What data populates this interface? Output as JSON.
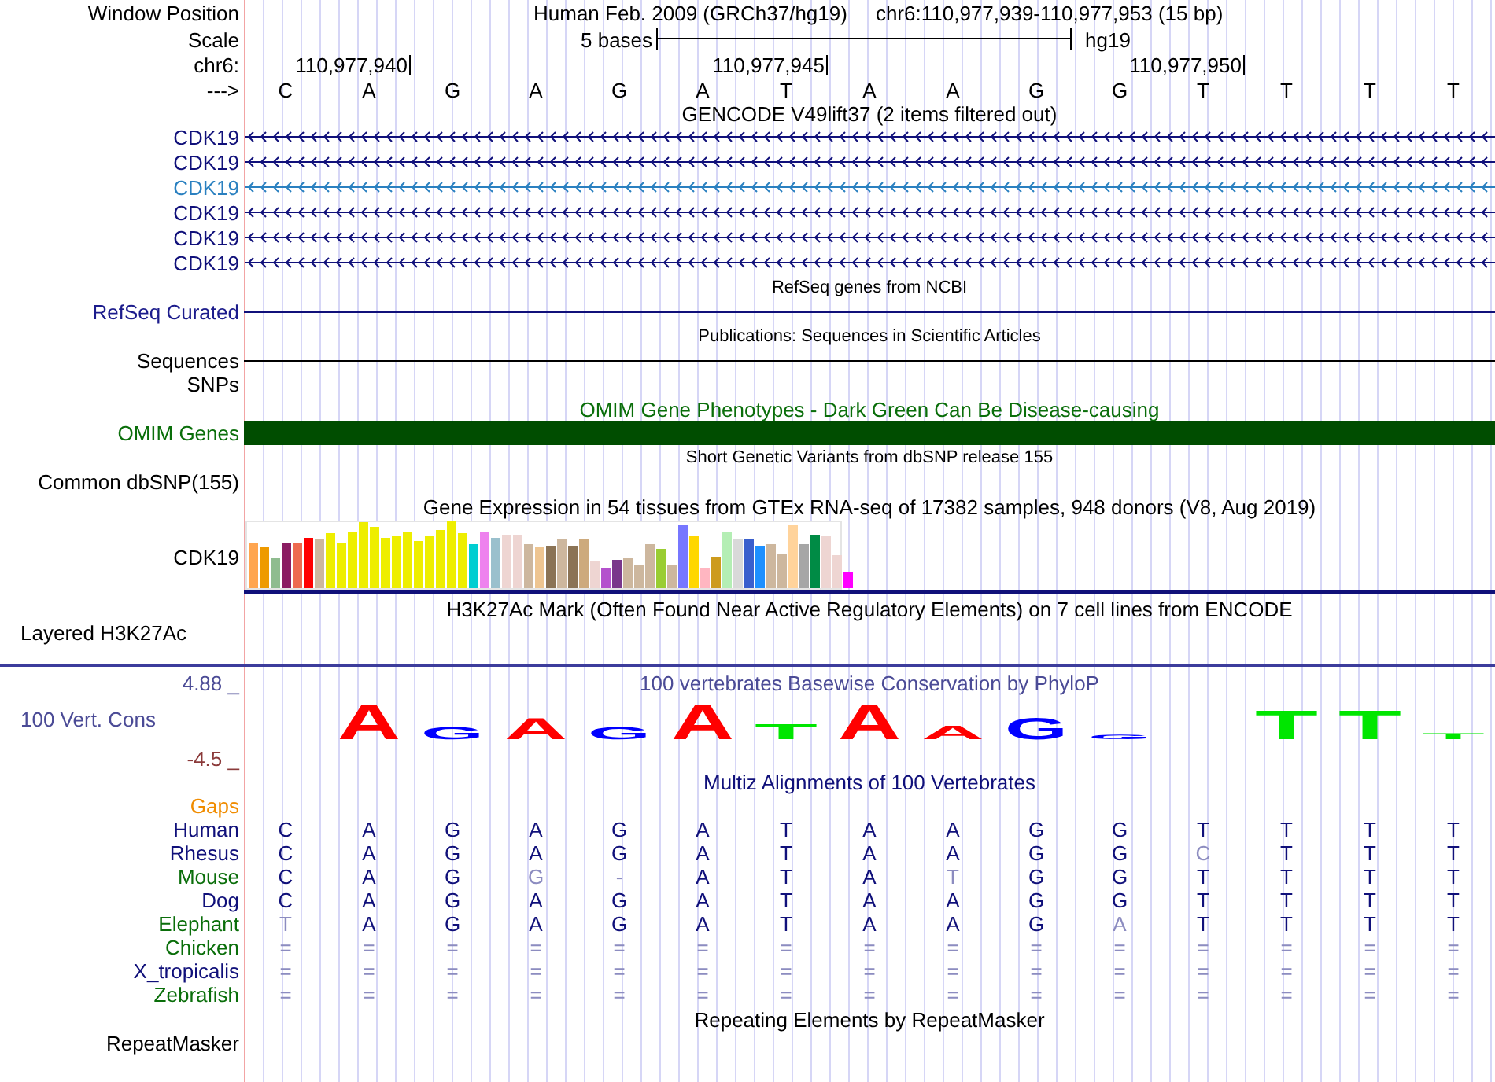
{
  "header": {
    "label": "Window Position",
    "assembly": "Human Feb. 2009 (GRCh37/hg19)",
    "position": "chr6:110,977,939-110,977,953 (15 bp)"
  },
  "scale": {
    "label": "Scale",
    "length": "5 bases",
    "database": "hg19"
  },
  "ruler": {
    "label": "chr6:",
    "ticks": [
      "110,977,940",
      "110,977,945",
      "110,977,950"
    ]
  },
  "bases": {
    "label": "--->",
    "sequence": [
      "C",
      "A",
      "G",
      "A",
      "G",
      "A",
      "T",
      "A",
      "A",
      "G",
      "G",
      "T",
      "T",
      "T",
      "T"
    ]
  },
  "tracks": [
    {
      "kind": "genes",
      "title": {
        "text": "GENCODE V49lift37 (2 items filtered out)",
        "color": "#000000"
      },
      "items": [
        {
          "name": "CDK19",
          "color": "#10107a"
        },
        {
          "name": "CDK19",
          "color": "#10107a"
        },
        {
          "name": "CDK19",
          "color": "#2a80c0"
        },
        {
          "name": "CDK19",
          "color": "#10107a"
        },
        {
          "name": "CDK19",
          "color": "#10107a"
        },
        {
          "name": "CDK19",
          "color": "#10107a"
        }
      ]
    },
    {
      "kind": "line",
      "title": {
        "text": "RefSeq genes from NCBI",
        "color": "#000000"
      },
      "color": "#10107a",
      "labels": [
        {
          "text": "RefSeq Curated",
          "color": "#1c1c8c"
        }
      ]
    },
    {
      "kind": "line",
      "title": {
        "text": "Publications: Sequences in Scientific Articles",
        "color": "#000000"
      },
      "color": "#000000",
      "labels": [
        {
          "text": "Sequences",
          "color": "#000000"
        },
        {
          "text": "SNPs",
          "color": "#000000"
        }
      ]
    },
    {
      "kind": "bar",
      "title": {
        "text": "OMIM Gene Phenotypes - Dark Green Can Be Disease-causing",
        "color": "#0a6e0a"
      },
      "color": "#004d00",
      "labels": [
        {
          "text": "OMIM Genes",
          "color": "#0a6e0a"
        }
      ]
    },
    {
      "kind": "variants",
      "title": {
        "text": "Short Genetic Variants from dbSNP release 155",
        "color": "#000000"
      },
      "labels": [
        {
          "text": "Common dbSNP(155)",
          "color": "#000000"
        }
      ]
    },
    {
      "kind": "expression",
      "title": {
        "text": "Gene Expression in 54 tissues from GTEx RNA-seq of 17382 samples, 948 donors (V8, Aug 2019)",
        "color": "#000000"
      },
      "labels": [
        {
          "text": "CDK19",
          "color": "#000000"
        }
      ],
      "bars": [
        {
          "color": "#ffa54f"
        },
        {
          "color": "#ee9a00"
        },
        {
          "color": "#8fbc8f"
        },
        {
          "color": "#8b1c62"
        },
        {
          "color": "#ee6a50"
        },
        {
          "color": "#ff0000"
        },
        {
          "color": "#cdb79e"
        },
        {
          "color": "#eeee00"
        },
        {
          "color": "#eeee00"
        },
        {
          "color": "#eeee00"
        },
        {
          "color": "#eeee00"
        },
        {
          "color": "#eeee00"
        },
        {
          "color": "#eeee00"
        },
        {
          "color": "#eeee00"
        },
        {
          "color": "#eeee00"
        },
        {
          "color": "#eeee00"
        },
        {
          "color": "#eeee00"
        },
        {
          "color": "#eeee00"
        },
        {
          "color": "#eeee00"
        },
        {
          "color": "#eeee00"
        },
        {
          "color": "#00ced1"
        },
        {
          "color": "#ee82ee"
        },
        {
          "color": "#9ac0cd"
        },
        {
          "color": "#eed5d2"
        },
        {
          "color": "#eed5d2"
        },
        {
          "color": "#cdb79e"
        },
        {
          "color": "#eec591"
        },
        {
          "color": "#8b7355"
        },
        {
          "color": "#cdb79e"
        },
        {
          "color": "#8b7355"
        },
        {
          "color": "#cdaa7d"
        },
        {
          "color": "#eed5d2"
        },
        {
          "color": "#b452cd"
        },
        {
          "color": "#7a378b"
        },
        {
          "color": "#cdb79e"
        },
        {
          "color": "#cdb79e"
        },
        {
          "color": "#cdb79e"
        },
        {
          "color": "#9acd32"
        },
        {
          "color": "#cdb79e"
        },
        {
          "color": "#7777ff"
        },
        {
          "color": "#ffd700"
        },
        {
          "color": "#ffb6c1"
        },
        {
          "color": "#cd9b1d"
        },
        {
          "color": "#b4eeb4"
        },
        {
          "color": "#d9d9d9"
        },
        {
          "color": "#3a5fcd"
        },
        {
          "color": "#1e90ff"
        },
        {
          "color": "#cdb79e"
        },
        {
          "color": "#cdb79e"
        },
        {
          "color": "#ffd39b"
        },
        {
          "color": "#a6a6a6"
        },
        {
          "color": "#008b45"
        },
        {
          "color": "#eed5d2"
        },
        {
          "color": "#eed5d2"
        },
        {
          "color": "#ff00ff"
        }
      ]
    },
    {
      "kind": "signal",
      "title": {
        "text": "H3K27Ac Mark (Often Found Near Active Regulatory Elements) on 7 cell lines from ENCODE",
        "color": "#000000"
      },
      "labels": [
        {
          "text": "Layered H3K27Ac",
          "color": "#000000"
        }
      ]
    },
    {
      "kind": "conservation",
      "title": {
        "text": "100 vertebrates Basewise Conservation by PhyloP",
        "color": "#4b4b96"
      },
      "max": "4.88 _",
      "min": "-4.5 _",
      "labels": [
        {
          "text": "100 Vert. Cons",
          "color": "#4b4b96"
        }
      ],
      "letters": [
        {
          "kind": "blank"
        },
        {
          "kind": "letter",
          "base": "A"
        },
        {
          "kind": "letter",
          "base": "G"
        },
        {
          "kind": "letter",
          "base": "A"
        },
        {
          "kind": "letter",
          "base": "G"
        },
        {
          "kind": "letter",
          "base": "A"
        },
        {
          "kind": "letter",
          "base": "T"
        },
        {
          "kind": "letter",
          "base": "A"
        },
        {
          "kind": "letter",
          "base": "A"
        },
        {
          "kind": "letter",
          "base": "G"
        },
        {
          "kind": "letter",
          "base": "G"
        },
        {
          "kind": "blank"
        },
        {
          "kind": "letter",
          "base": "T"
        },
        {
          "kind": "letter",
          "base": "T"
        },
        {
          "kind": "letter",
          "base": "T"
        }
      ]
    },
    {
      "kind": "alignment",
      "title": {
        "text": "Multiz Alignments of 100 Vertebrates",
        "color": "#10107a"
      },
      "gaps": {
        "text": "Gaps",
        "color": "#f08c00"
      },
      "species": [
        {
          "name": "Human",
          "color": "#10107a",
          "bases": [
            "C",
            "A",
            "G",
            "A",
            "G",
            "A",
            "T",
            "A",
            "A",
            "G",
            "G",
            "T",
            "T",
            "T",
            "T"
          ]
        },
        {
          "name": "Rhesus",
          "color": "#10107a",
          "bases": [
            "C",
            "A",
            "G",
            "A",
            "G",
            "A",
            "T",
            "A",
            "A",
            "G",
            "G",
            "C",
            "T",
            "T",
            "T"
          ]
        },
        {
          "name": "Mouse",
          "color": "#0a6e0a",
          "bases": [
            "C",
            "A",
            "G",
            "G",
            "-",
            "A",
            "T",
            "A",
            "T",
            "G",
            "G",
            "T",
            "T",
            "T",
            "T"
          ]
        },
        {
          "name": "Dog",
          "color": "#10107a",
          "bases": [
            "C",
            "A",
            "G",
            "A",
            "G",
            "A",
            "T",
            "A",
            "A",
            "G",
            "G",
            "T",
            "T",
            "T",
            "T"
          ]
        },
        {
          "name": "Elephant",
          "color": "#0a6e0a",
          "bases": [
            "T",
            "A",
            "G",
            "A",
            "G",
            "A",
            "T",
            "A",
            "A",
            "G",
            "A",
            "T",
            "T",
            "T",
            "T"
          ]
        },
        {
          "name": "Chicken",
          "color": "#0a6e0a",
          "bases": [
            "=",
            "=",
            "=",
            "=",
            "=",
            "=",
            "=",
            "=",
            "=",
            "=",
            "=",
            "=",
            "=",
            "=",
            "="
          ]
        },
        {
          "name": "X_tropicalis",
          "color": "#10107a",
          "bases": [
            "=",
            "=",
            "=",
            "=",
            "=",
            "=",
            "=",
            "=",
            "=",
            "=",
            "=",
            "=",
            "=",
            "=",
            "="
          ]
        },
        {
          "name": "Zebrafish",
          "color": "#0a6e0a",
          "bases": [
            "=",
            "=",
            "=",
            "=",
            "=",
            "=",
            "=",
            "=",
            "=",
            "=",
            "=",
            "=",
            "=",
            "=",
            "="
          ]
        }
      ]
    },
    {
      "kind": "repeats",
      "title": {
        "text": "Repeating Elements by RepeatMasker",
        "color": "#000000"
      },
      "labels": [
        {
          "text": "RepeatMasker",
          "color": "#000000"
        }
      ]
    }
  ]
}
